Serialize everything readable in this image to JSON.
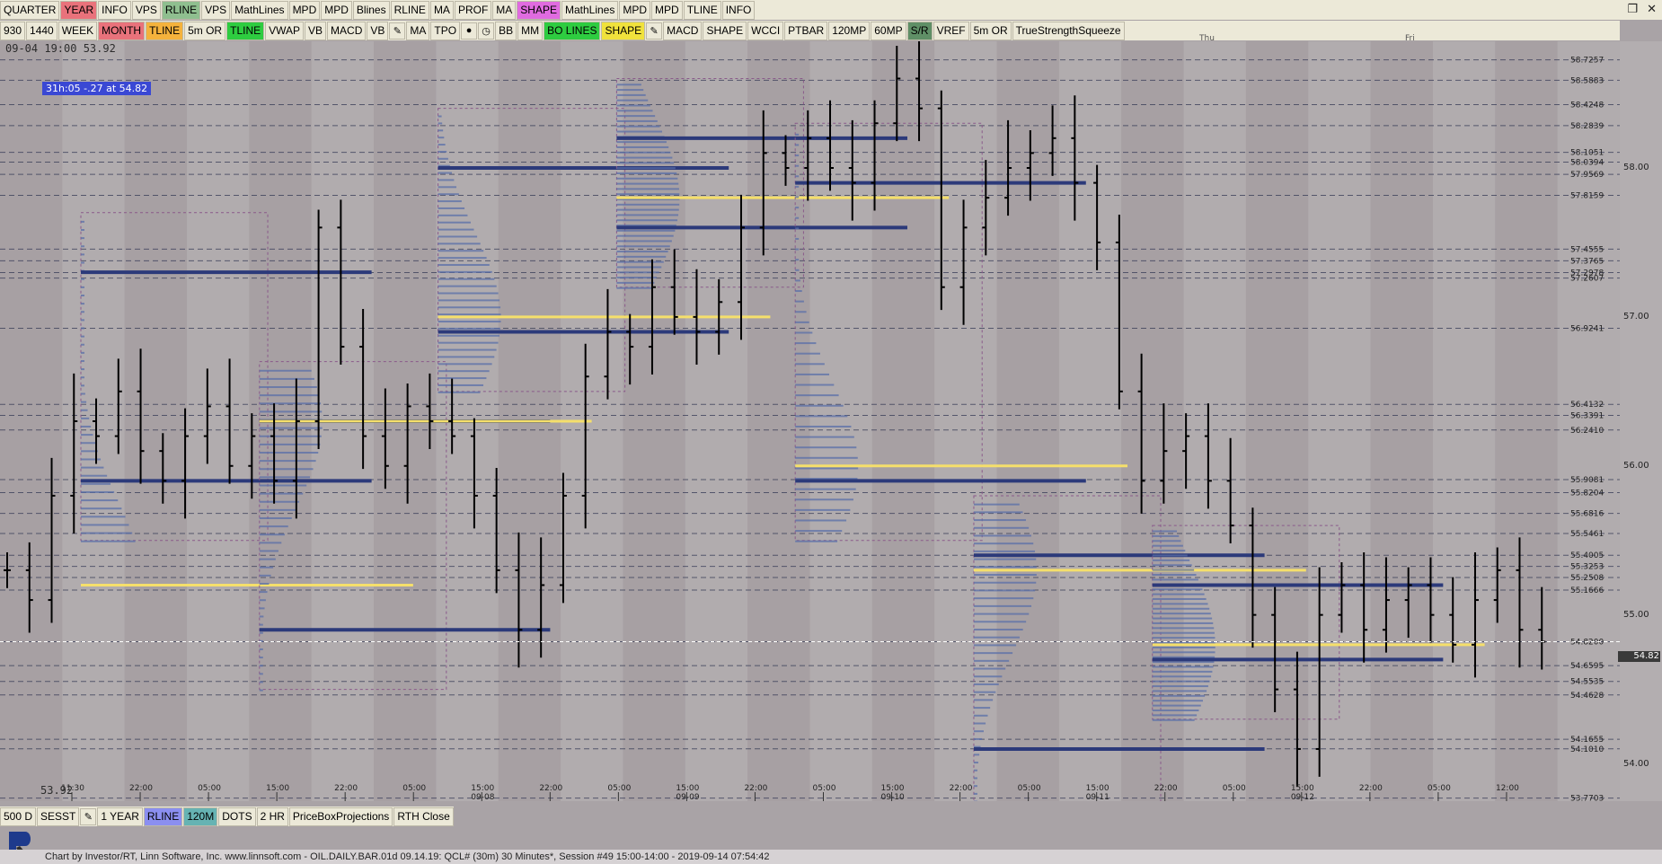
{
  "toolbar_top": {
    "buttons": [
      {
        "label": "QUARTER",
        "bg": ""
      },
      {
        "label": "YEAR",
        "bg": "#e9727b"
      },
      {
        "label": "INFO",
        "bg": ""
      },
      {
        "label": "VPS",
        "bg": ""
      },
      {
        "label": "RLINE",
        "bg": "#8fbf8f"
      },
      {
        "label": "VPS",
        "bg": ""
      },
      {
        "label": "MathLines",
        "bg": ""
      },
      {
        "label": "MPD",
        "bg": ""
      },
      {
        "label": "MPD",
        "bg": ""
      },
      {
        "label": "Blines",
        "bg": ""
      },
      {
        "label": "RLINE",
        "bg": ""
      },
      {
        "label": "MA",
        "bg": ""
      },
      {
        "label": "PROF",
        "bg": ""
      },
      {
        "label": "MA",
        "bg": ""
      },
      {
        "label": "SHAPE",
        "bg": "#e06be0"
      },
      {
        "label": "MathLines",
        "bg": ""
      },
      {
        "label": "MPD",
        "bg": ""
      },
      {
        "label": "MPD",
        "bg": ""
      },
      {
        "label": "TLINE",
        "bg": ""
      },
      {
        "label": "INFO",
        "bg": ""
      }
    ]
  },
  "toolbar_second": {
    "buttons": [
      {
        "label": "930",
        "bg": ""
      },
      {
        "label": "1440",
        "bg": ""
      },
      {
        "label": "WEEK",
        "bg": ""
      },
      {
        "label": "MONTH",
        "bg": "#e9727b"
      },
      {
        "label": "TLINE",
        "bg": "#f4b23c"
      },
      {
        "label": "5m OR",
        "bg": ""
      },
      {
        "label": "TLINE",
        "bg": "#2ecc40"
      },
      {
        "label": "VWAP",
        "bg": ""
      },
      {
        "label": "VB",
        "bg": ""
      },
      {
        "label": "MACD",
        "bg": ""
      },
      {
        "label": "VB",
        "bg": ""
      },
      {
        "label": "pencil-icon",
        "bg": "",
        "icon": "✎"
      },
      {
        "label": "MA",
        "bg": ""
      },
      {
        "label": "TPO",
        "bg": ""
      },
      {
        "label": "drop-icon",
        "bg": "",
        "icon": "●"
      },
      {
        "label": "clock-icon",
        "bg": "",
        "icon": "◷"
      },
      {
        "label": "BB",
        "bg": ""
      },
      {
        "label": "MM",
        "bg": ""
      },
      {
        "label": "BO LINES",
        "bg": "#2ecc40"
      },
      {
        "label": "SHAPE",
        "bg": "#f0e23c"
      },
      {
        "label": "pencil-icon",
        "bg": "",
        "icon": "✎"
      },
      {
        "label": "MACD",
        "bg": ""
      },
      {
        "label": "SHAPE",
        "bg": ""
      },
      {
        "label": "WCCI",
        "bg": ""
      },
      {
        "label": "PTBAR",
        "bg": ""
      },
      {
        "label": "120MP",
        "bg": ""
      },
      {
        "label": "60MP",
        "bg": ""
      },
      {
        "label": "S/R",
        "bg": "#5f8f66"
      },
      {
        "label": "VREF",
        "bg": ""
      },
      {
        "label": "5m OR",
        "bg": ""
      },
      {
        "label": "TrueStrengthSqueeze",
        "bg": ""
      }
    ]
  },
  "toolbar_bottom": {
    "buttons": [
      {
        "label": "500 D",
        "bg": ""
      },
      {
        "label": "SESST",
        "bg": ""
      },
      {
        "label": "pencil-icon",
        "bg": "",
        "icon": "✎"
      },
      {
        "label": "1 YEAR",
        "bg": ""
      },
      {
        "label": "RLINE",
        "bg": "#8b8ff0"
      },
      {
        "label": "120M",
        "bg": "#66b3b3"
      },
      {
        "label": "DOTS",
        "bg": ""
      },
      {
        "label": "2 HR",
        "bg": ""
      },
      {
        "label": "PriceBoxProjections",
        "bg": ""
      },
      {
        "label": "RTH Close",
        "bg": ""
      }
    ]
  },
  "status": {
    "top": "09-04 19:00  53.92",
    "bottom": "53.92",
    "badge": "31h:05  -.27 at 54.82",
    "current_price": "54.82"
  },
  "day_labels": [
    "Thu",
    "Fri"
  ],
  "footer": "Chart by Investor/RT, Linn Software, Inc. www.linnsoft.com - OIL.DAILY.BAR.01d  09.14.19: QCL# (30m) 30 Minutes*, Session #49 15:00-14:00 - 2019-09-14 07:54:42",
  "chart_data": {
    "type": "candlestick",
    "symbol": "QCL#",
    "interval": "30 Minutes",
    "ylim": [
      53.75,
      58.85
    ],
    "y_ticks": [
      54.0,
      55.0,
      56.0,
      57.0,
      58.0
    ],
    "y_tick_labels": [
      "54.00",
      "55.00",
      "56.00",
      "57.00",
      "58.00"
    ],
    "level_labels": [
      "58.7257",
      "58.5883",
      "58.4248",
      "58.2839",
      "58.1051",
      "58.0394",
      "57.9569",
      "57.8159",
      "57.4555",
      "57.3765",
      "57.2978",
      "57.2607",
      "56.9241",
      "56.4132",
      "56.3391",
      "56.2410",
      "55.9081",
      "55.8204",
      "55.6816",
      "55.5461",
      "55.4005",
      "55.3253",
      "55.2508",
      "55.1666",
      "54.8200",
      "54.6595",
      "54.5535",
      "54.4628",
      "54.1655",
      "54.1010",
      "53.7703"
    ],
    "x_tick_labels": [
      "11:30",
      "22:00",
      "05:00",
      "15:00",
      "22:00",
      "05:00",
      "15:00 09-08",
      "22:00",
      "05:00",
      "15:00 09-09",
      "22:00",
      "05:00",
      "15:00 09-10",
      "22:00",
      "05:00",
      "15:00 09-11",
      "22:00",
      "05:00",
      "15:00 09-12",
      "22:00",
      "05:00",
      "12:00"
    ],
    "price_path": [
      55.3,
      55.1,
      55.8,
      56.3,
      56.2,
      56.5,
      56.1,
      55.9,
      56.2,
      56.4,
      56.0,
      56.2,
      55.9,
      56.3,
      57.6,
      56.8,
      56.2,
      56.0,
      56.4,
      56.3,
      56.2,
      55.8,
      55.3,
      54.9,
      55.2,
      55.8,
      56.6,
      56.9,
      56.8,
      57.2,
      57.0,
      56.9,
      57.1,
      57.6,
      58.1,
      58.0,
      58.2,
      58.0,
      57.9,
      58.3,
      58.6,
      58.4,
      57.2,
      57.6,
      57.8,
      58.0,
      58.1,
      58.2,
      57.9,
      57.5,
      56.5,
      55.9,
      56.1,
      56.2,
      55.9,
      55.6,
      55.0,
      54.5,
      54.1,
      55.0,
      55.2,
      54.9,
      55.1,
      55.2,
      55.0,
      54.8,
      55.1,
      55.3,
      54.9,
      54.82
    ],
    "session_boundaries_pct": [
      5.0,
      17.5,
      30.0,
      42.5,
      55.0,
      67.5,
      80.0,
      92.5
    ],
    "poc_levels": [
      55.2,
      56.3,
      57.0,
      57.8,
      56.0,
      55.3,
      54.8
    ],
    "value_area_highs": [
      57.3,
      56.3,
      58.0,
      58.2,
      57.9,
      55.4,
      55.2
    ],
    "value_area_lows": [
      55.9,
      54.9,
      56.9,
      57.6,
      55.9,
      54.1,
      54.7
    ]
  }
}
